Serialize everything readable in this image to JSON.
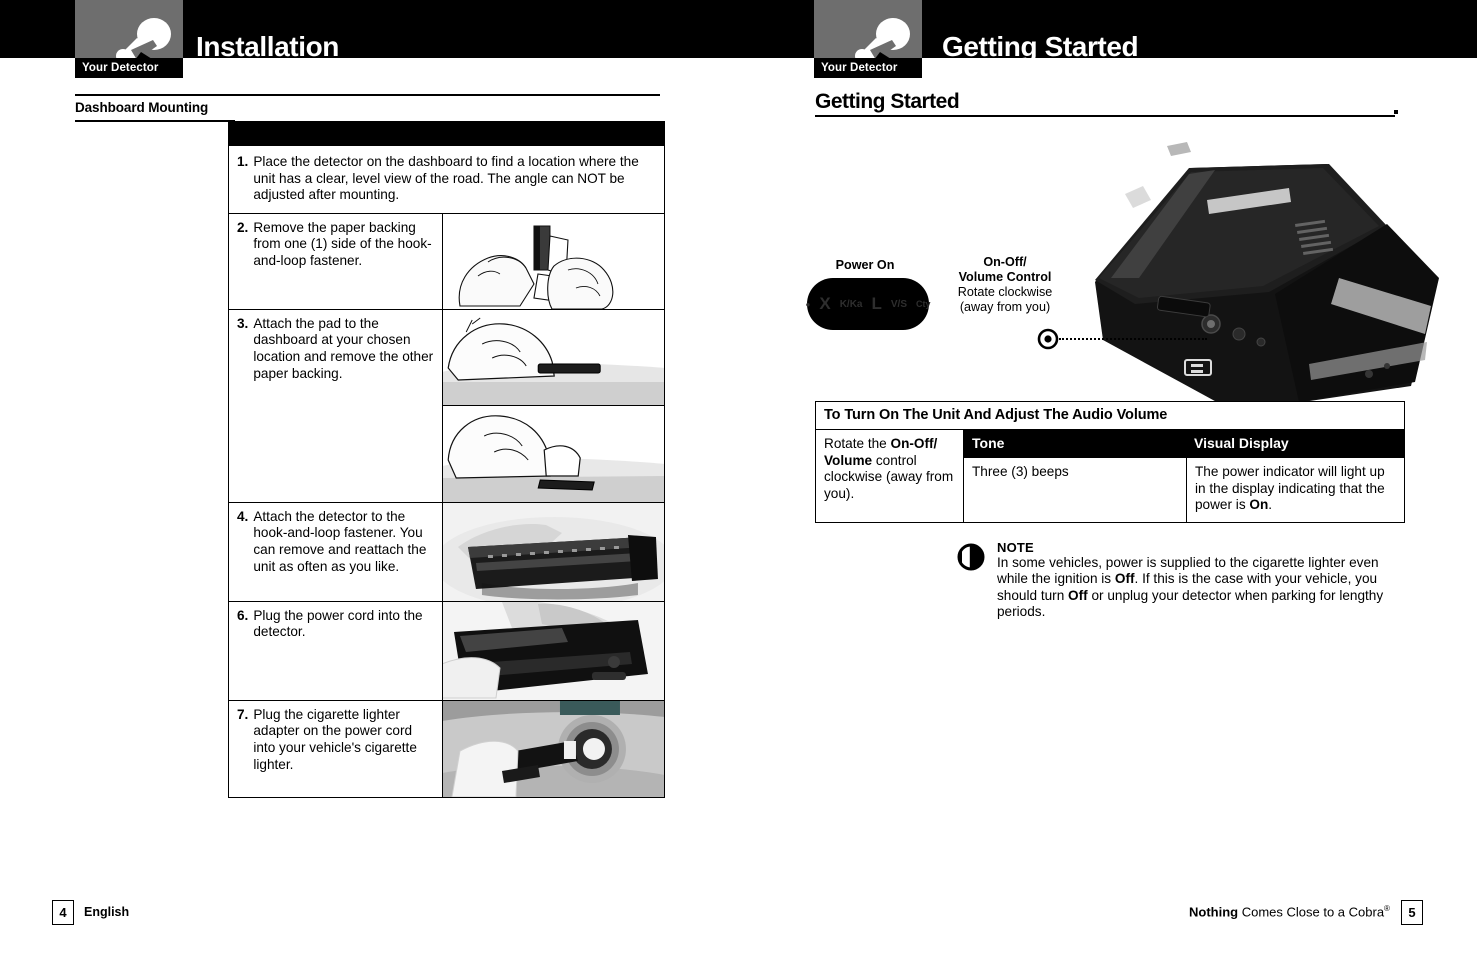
{
  "document": {
    "chapter_tab_label": "Your Detector"
  },
  "left_page": {
    "chapter_title": "Installation",
    "section_heading": "Dashboard Mounting",
    "steps": [
      {
        "number": "1.",
        "text": "Place the detector on the dashboard to find a location where the unit has a clear, level view of the road. The angle can NOT be adjusted after mounting.",
        "image": "none"
      },
      {
        "number": "2.",
        "text": "Remove the paper backing from one (1) side of the hook-and-loop fastener.",
        "image": "hand-peeling-fastener-illustration"
      },
      {
        "number": "3.",
        "text": "Attach the pad to the dashboard at your chosen location and remove the other paper backing.",
        "image": "hand-pressing-pad-to-dashboard-illustration"
      },
      {
        "number": "4.",
        "text": "Attach the detector to the hook-and-loop fastener. You can remove and reattach the unit as often as you like.",
        "image": "detector-on-fastener-photo"
      },
      {
        "number": "6.",
        "text": "Plug the power cord into the detector.",
        "image": "power-cord-into-detector-photo"
      },
      {
        "number": "7.",
        "text": "Plug the cigarette lighter adapter on the power cord into your vehicle's cigarette lighter.",
        "image": "cigarette-lighter-plug-photo"
      }
    ],
    "footer": {
      "page_number": "4",
      "language": "English"
    }
  },
  "right_page": {
    "chapter_title": "Getting Started",
    "section_heading": "Getting Started",
    "product_photo": "cobra-radar-detector-photo",
    "callouts": {
      "power_on": {
        "label": "Power On",
        "display_segments": [
          "X",
          "K/Ka",
          "L",
          "V/S",
          "Cty"
        ],
        "power_dot": "power-indicator-dot"
      },
      "volume_control": {
        "title_line1": "On-Off/",
        "title_line2": "Volume Control",
        "desc_line1": "Rotate clockwise",
        "desc_line2": "(away from you)"
      }
    },
    "table": {
      "title": "To Turn On The Unit And Adjust The Audio Volume",
      "action_cell": {
        "pre": "Rotate the ",
        "bold1": "On-Off/",
        "bold2": "Volume",
        "mid": " control clockwise (away from you)."
      },
      "columns": [
        "Tone",
        "Visual Display"
      ],
      "rows": [
        {
          "tone": "Three (3) beeps",
          "visual_pre": "The power indicator will light up in the display indicating that the power is ",
          "visual_bold": "On",
          "visual_post": "."
        }
      ]
    },
    "note": {
      "title": "NOTE",
      "part1": "In some vehicles, power is supplied to the cigarette lighter even while the ignition is ",
      "bold1": "Off",
      "part2": ". If this is the case with your vehicle, you should turn ",
      "bold2": "Off",
      "part3": " or unplug your detector when parking for lengthy periods."
    },
    "footer": {
      "page_number": "5",
      "tagline_bold": "Nothing",
      "tagline_rest": " Comes Close to a Cobra",
      "tagline_mark": "®"
    }
  },
  "colors": {
    "band": "#000000",
    "tab_gray": "#6e6e6e",
    "paper": "#ffffff"
  }
}
